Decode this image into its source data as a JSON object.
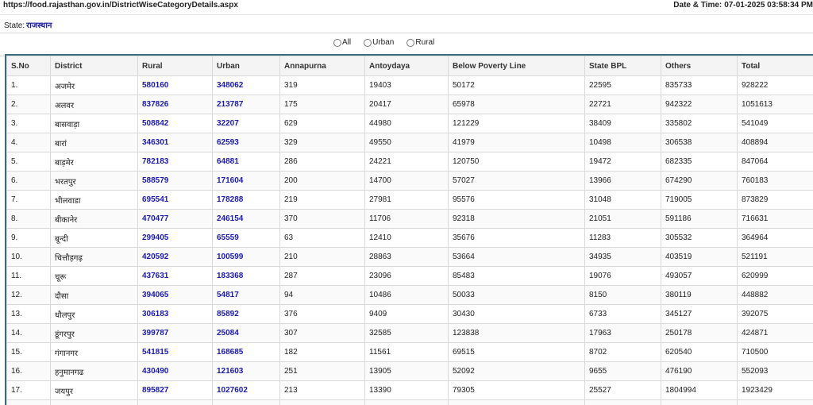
{
  "header": {
    "url": "https://food.rajasthan.gov.in/DistrictWiseCategoryDetails.aspx",
    "datetime_label": "Date & Time:",
    "datetime_value": "07-01-2025 03:58:34 PM"
  },
  "state": {
    "label": "State:",
    "value": "राजस्थान"
  },
  "filters": {
    "options": [
      "All",
      "Urban",
      "Rural"
    ]
  },
  "table": {
    "columns": [
      "S.No",
      "District",
      "Rural",
      "Urban",
      "Annapurna",
      "Antoydaya",
      "Below Poverty Line",
      "State BPL",
      "Others",
      "Total"
    ],
    "rows": [
      [
        "1.",
        "अजमेर",
        "580160",
        "348062",
        "319",
        "19403",
        "50172",
        "22595",
        "835733",
        "928222"
      ],
      [
        "2.",
        "अलवर",
        "837826",
        "213787",
        "175",
        "20417",
        "65978",
        "22721",
        "942322",
        "1051613"
      ],
      [
        "3.",
        "बासवाड़ा",
        "508842",
        "32207",
        "629",
        "44980",
        "121229",
        "38409",
        "335802",
        "541049"
      ],
      [
        "4.",
        "बारां",
        "346301",
        "62593",
        "329",
        "49550",
        "41979",
        "10498",
        "306538",
        "408894"
      ],
      [
        "5.",
        "बाड़मेर",
        "782183",
        "64881",
        "286",
        "24221",
        "120750",
        "19472",
        "682335",
        "847064"
      ],
      [
        "6.",
        "भरतपुर",
        "588579",
        "171604",
        "200",
        "14700",
        "57027",
        "13966",
        "674290",
        "760183"
      ],
      [
        "7.",
        "भीलवाडा",
        "695541",
        "178288",
        "219",
        "27981",
        "95576",
        "31048",
        "719005",
        "873829"
      ],
      [
        "8.",
        "बीकानेर",
        "470477",
        "246154",
        "370",
        "11706",
        "92318",
        "21051",
        "591186",
        "716631"
      ],
      [
        "9.",
        "बून्दी",
        "299405",
        "65559",
        "63",
        "12410",
        "35676",
        "11283",
        "305532",
        "364964"
      ],
      [
        "10.",
        "चित्तौड़गढ़",
        "420592",
        "100599",
        "210",
        "28863",
        "53664",
        "34935",
        "403519",
        "521191"
      ],
      [
        "11.",
        "चूरू",
        "437631",
        "183368",
        "287",
        "23096",
        "85483",
        "19076",
        "493057",
        "620999"
      ],
      [
        "12.",
        "दौसा",
        "394065",
        "54817",
        "94",
        "10486",
        "50033",
        "8150",
        "380119",
        "448882"
      ],
      [
        "13.",
        "धौलपुर",
        "306183",
        "85892",
        "376",
        "9409",
        "30430",
        "6733",
        "345127",
        "392075"
      ],
      [
        "14.",
        "डूंगरपुर",
        "399787",
        "25084",
        "307",
        "32585",
        "123838",
        "17963",
        "250178",
        "424871"
      ],
      [
        "15.",
        "गंगानगर",
        "541815",
        "168685",
        "182",
        "11561",
        "69515",
        "8702",
        "620540",
        "710500"
      ],
      [
        "16.",
        "हनुमानगढ",
        "430490",
        "121603",
        "251",
        "13905",
        "52092",
        "9655",
        "476190",
        "552093"
      ],
      [
        "17.",
        "जयपुर",
        "895827",
        "1027602",
        "213",
        "13390",
        "79305",
        "25527",
        "1804994",
        "1923429"
      ],
      [
        "",
        "",
        "",
        "",
        "",
        "",
        "",
        "",
        "",
        ""
      ]
    ]
  }
}
